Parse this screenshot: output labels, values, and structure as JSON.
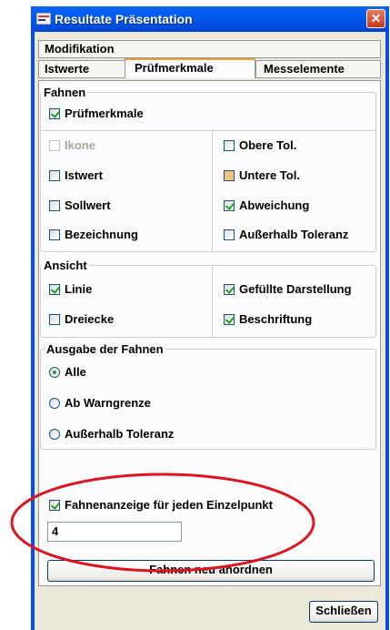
{
  "window": {
    "title": "Resultate Präsentation",
    "close_glyph": "✕"
  },
  "tabs": {
    "top_row": [
      "Modifikation"
    ],
    "bottom_row": [
      "Istwerte",
      "Prüfmerkmale",
      "Messelemente"
    ],
    "active": "Prüfmerkmale"
  },
  "fahnen": {
    "legend": "Fahnen",
    "pruefmerkmale": {
      "label": "Prüfmerkmale",
      "checked": true
    },
    "left": [
      {
        "label": "Ikone",
        "checked": false,
        "disabled": true
      },
      {
        "label": "Istwert",
        "checked": false
      },
      {
        "label": "Sollwert",
        "checked": false
      },
      {
        "label": "Bezeichnung",
        "checked": false
      }
    ],
    "right": [
      {
        "label": "Obere Tol.",
        "checked": false
      },
      {
        "label": "Untere Tol.",
        "checked": false,
        "indeterminate": true
      },
      {
        "label": "Abweichung",
        "checked": true
      },
      {
        "label": "Außerhalb Toleranz",
        "checked": false
      }
    ]
  },
  "ansicht": {
    "legend": "Ansicht",
    "left": [
      {
        "label": "Linie",
        "checked": true
      },
      {
        "label": "Dreiecke",
        "checked": false
      }
    ],
    "right": [
      {
        "label": "Gefüllte Darstellung",
        "checked": true
      },
      {
        "label": "Beschriftung",
        "checked": true
      }
    ]
  },
  "ausgabe": {
    "legend": "Ausgabe der Fahnen",
    "options": [
      {
        "label": "Alle",
        "selected": true
      },
      {
        "label": "Ab Warngrenze",
        "selected": false
      },
      {
        "label": "Außerhalb Toleranz",
        "selected": false
      }
    ]
  },
  "einzelpunkt": {
    "label": "Fahnenanzeige für jeden Einzelpunkt",
    "checked": true
  },
  "input_value": "4",
  "buttons": {
    "rearrange": "Fahnen neu anordnen",
    "close": "Schließen"
  },
  "colors": {
    "titlebar": "#0058ee",
    "client": "#ece9d8",
    "check_green": "#21a121",
    "annotation_red": "#e0141e"
  }
}
